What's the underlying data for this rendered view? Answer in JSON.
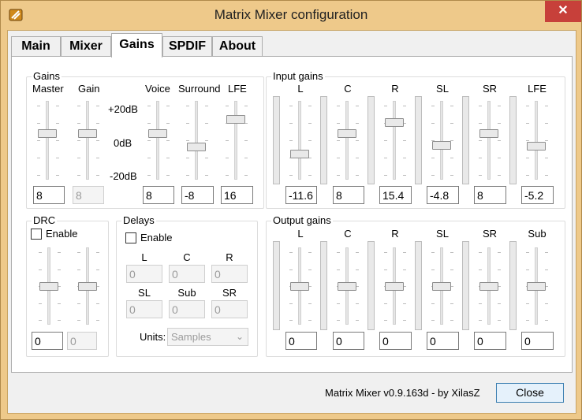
{
  "window": {
    "title": "Matrix Mixer configuration",
    "close_glyph": "✕"
  },
  "tabs": [
    "Main",
    "Mixer",
    "Gains",
    "SPDIF",
    "About"
  ],
  "active_tab": "Gains",
  "gains": {
    "title": "Gains",
    "headers": [
      "Master",
      "Gain",
      "Voice",
      "Surround",
      "LFE"
    ],
    "scale": [
      "+20dB",
      "0dB",
      "-20dB"
    ],
    "values": [
      "8",
      "8",
      "8",
      "-8",
      "16"
    ]
  },
  "input_gains": {
    "title": "Input gains",
    "channels": [
      "L",
      "C",
      "R",
      "SL",
      "SR",
      "LFE"
    ],
    "values": [
      "-11.6",
      "8",
      "15.4",
      "-4.8",
      "8",
      "-5.2"
    ]
  },
  "drc": {
    "title": "DRC",
    "enable_label": "Enable",
    "values": [
      "0",
      "0"
    ]
  },
  "delays": {
    "title": "Delays",
    "enable_label": "Enable",
    "labels_row1": [
      "L",
      "C",
      "R"
    ],
    "labels_row2": [
      "SL",
      "Sub",
      "SR"
    ],
    "values_row1": [
      "0",
      "0",
      "0"
    ],
    "values_row2": [
      "0",
      "0",
      "0"
    ],
    "units_label": "Units:",
    "units_value": "Samples"
  },
  "output_gains": {
    "title": "Output gains",
    "channels": [
      "L",
      "C",
      "R",
      "SL",
      "SR",
      "Sub"
    ],
    "values": [
      "0",
      "0",
      "0",
      "0",
      "0",
      "0"
    ]
  },
  "footer": {
    "version_text": "Matrix Mixer v0.9.163d -  by XilasZ",
    "close_label": "Close"
  },
  "colors": {
    "titlebar": "#eec98a",
    "close_button": "#c7403a",
    "accent_border": "#3c7fb1"
  }
}
